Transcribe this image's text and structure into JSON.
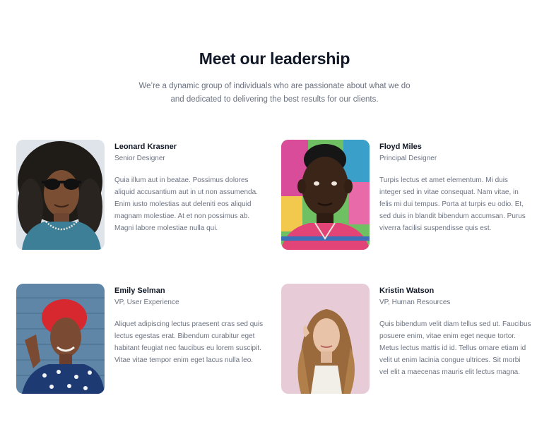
{
  "header": {
    "title": "Meet our leadership",
    "subtitle": "We’re a dynamic group of individuals who are passionate about what we do and dedicated to delivering the best results for our clients."
  },
  "team": [
    {
      "name": "Leonard Krasner",
      "role": "Senior Designer",
      "bio": "Quia illum aut in beatae. Possimus dolores aliquid accusantium aut in ut non assumenda. Enim iusto molestias aut deleniti eos aliquid magnam molestiae. At et non possimus ab. Magni labore molestiae nulla qui.",
      "photo_bg": "#dfe4ea"
    },
    {
      "name": "Floyd Miles",
      "role": "Principal Designer",
      "bio": "Turpis lectus et amet elementum. Mi duis integer sed in vitae consequat. Nam vitae, in felis mi dui tempus. Porta at turpis eu odio. Et, sed duis in blandit bibendum accumsan. Purus viverra facilisi suspendisse quis est.",
      "photo_bg": "#6fbf63"
    },
    {
      "name": "Emily Selman",
      "role": "VP, User Experience",
      "bio": "Aliquet adipiscing lectus praesent cras sed quis lectus egestas erat. Bibendum curabitur eget habitant feugiat nec faucibus eu lorem suscipit. Vitae vitae tempor enim eget lacus nulla leo.",
      "photo_bg": "#5f86a6"
    },
    {
      "name": "Kristin Watson",
      "role": "VP, Human Resources",
      "bio": "Quis bibendum velit diam tellus sed ut. Faucibus posuere enim, vitae enim eget neque tortor. Metus lectus mattis id id. Tellus ornare etiam id velit ut enim lacinia congue ultrices. Sit morbi vel elit a maecenas mauris elit lectus magna.",
      "photo_bg": "#e7ccd8"
    }
  ]
}
